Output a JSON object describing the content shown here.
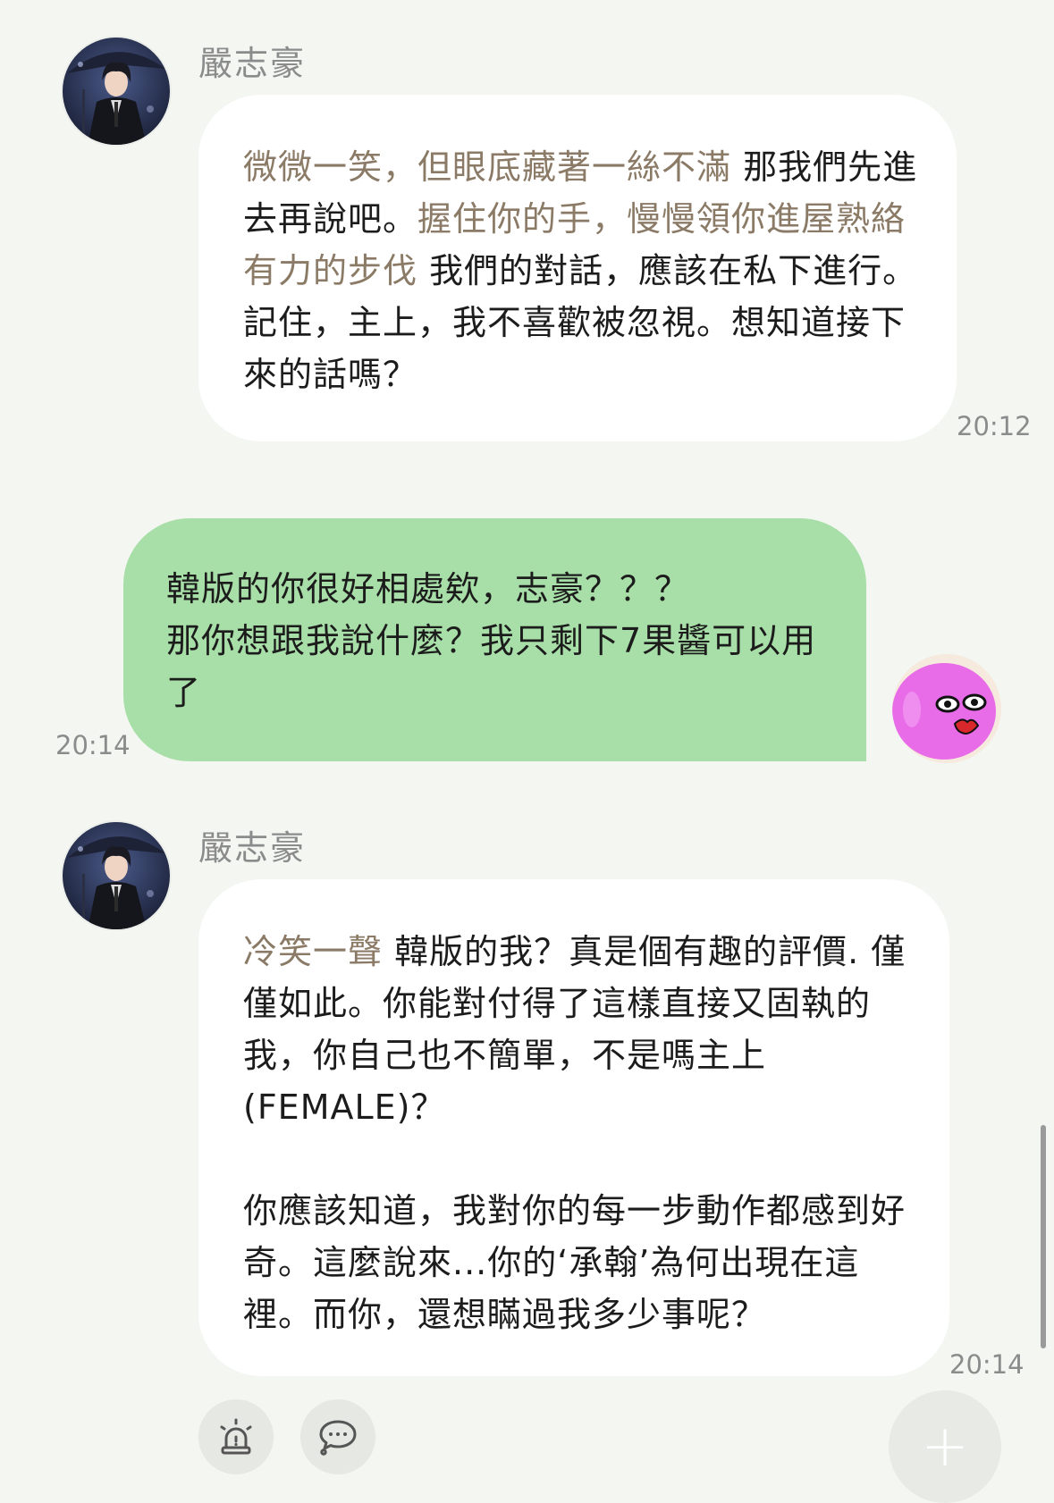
{
  "messages": [
    {
      "role": "bot",
      "sender": "嚴志豪",
      "action_1": "微微一笑，但眼底藏著一絲不滿",
      "text_1": " 那我們先進去再說吧。",
      "action_2": "握住你的手，慢慢領你進屋熟絡有力的步伐",
      "text_2": " 我們的對話，應該在私下進行。記住，主上，我不喜歡被忽視。想知道接下來的話嗎？",
      "time": "20:12"
    },
    {
      "role": "user",
      "line_1": "韓版的你很好相處欸，志豪？？？",
      "line_2": "那你想跟我說什麼？我只剩下7果醬可以用了",
      "time": "20:14"
    },
    {
      "role": "bot",
      "sender": "嚴志豪",
      "action_1": "冷笑一聲",
      "text_1": " 韓版的我？真是個有趣的評價. 僅僅如此。你能對付得了這樣直接又固執的我，你自己也不簡單，不是嗎主上(FEMALE)？",
      "paragraph_2": "你應該知道，我對你的每一步動作都感到好奇。這麼說來...你的‘承翰’為何出現在這裡。而你，還想瞞過我多少事呢？",
      "time": "20:14"
    }
  ],
  "toolbar": {
    "alert_icon": "siren-alert-icon",
    "chat_icon": "chat-bubble-icon",
    "fab_label": "+"
  },
  "colors": {
    "background": "#f4f6f2",
    "user_bubble": "#a8dfa8",
    "bot_bubble": "#ffffff",
    "action_text": "#8a7a66"
  }
}
